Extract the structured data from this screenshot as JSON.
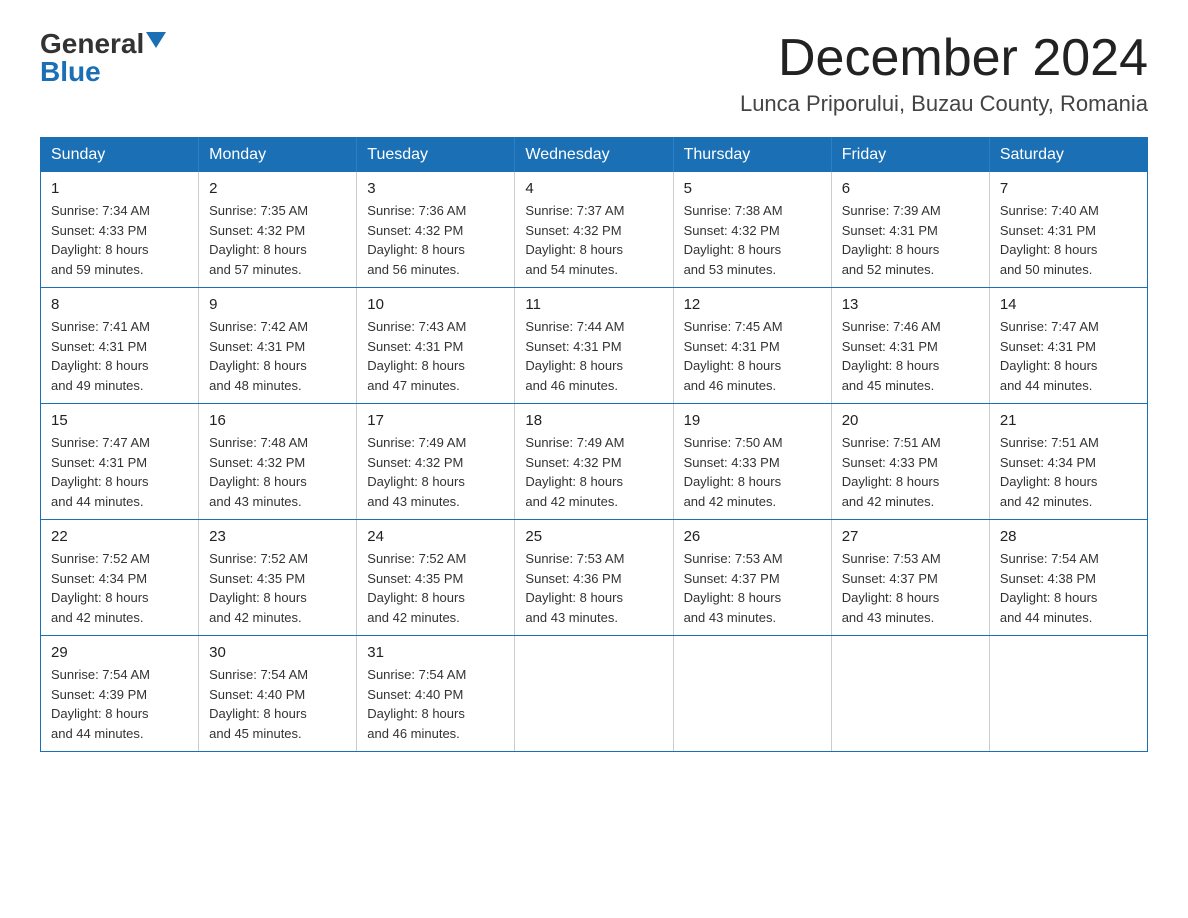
{
  "header": {
    "logo_general": "General",
    "logo_blue": "Blue",
    "month_title": "December 2024",
    "location": "Lunca Priporului, Buzau County, Romania"
  },
  "days_of_week": [
    "Sunday",
    "Monday",
    "Tuesday",
    "Wednesday",
    "Thursday",
    "Friday",
    "Saturday"
  ],
  "weeks": [
    [
      {
        "day": "1",
        "sunrise": "7:34 AM",
        "sunset": "4:33 PM",
        "daylight": "8 hours and 59 minutes."
      },
      {
        "day": "2",
        "sunrise": "7:35 AM",
        "sunset": "4:32 PM",
        "daylight": "8 hours and 57 minutes."
      },
      {
        "day": "3",
        "sunrise": "7:36 AM",
        "sunset": "4:32 PM",
        "daylight": "8 hours and 56 minutes."
      },
      {
        "day": "4",
        "sunrise": "7:37 AM",
        "sunset": "4:32 PM",
        "daylight": "8 hours and 54 minutes."
      },
      {
        "day": "5",
        "sunrise": "7:38 AM",
        "sunset": "4:32 PM",
        "daylight": "8 hours and 53 minutes."
      },
      {
        "day": "6",
        "sunrise": "7:39 AM",
        "sunset": "4:31 PM",
        "daylight": "8 hours and 52 minutes."
      },
      {
        "day": "7",
        "sunrise": "7:40 AM",
        "sunset": "4:31 PM",
        "daylight": "8 hours and 50 minutes."
      }
    ],
    [
      {
        "day": "8",
        "sunrise": "7:41 AM",
        "sunset": "4:31 PM",
        "daylight": "8 hours and 49 minutes."
      },
      {
        "day": "9",
        "sunrise": "7:42 AM",
        "sunset": "4:31 PM",
        "daylight": "8 hours and 48 minutes."
      },
      {
        "day": "10",
        "sunrise": "7:43 AM",
        "sunset": "4:31 PM",
        "daylight": "8 hours and 47 minutes."
      },
      {
        "day": "11",
        "sunrise": "7:44 AM",
        "sunset": "4:31 PM",
        "daylight": "8 hours and 46 minutes."
      },
      {
        "day": "12",
        "sunrise": "7:45 AM",
        "sunset": "4:31 PM",
        "daylight": "8 hours and 46 minutes."
      },
      {
        "day": "13",
        "sunrise": "7:46 AM",
        "sunset": "4:31 PM",
        "daylight": "8 hours and 45 minutes."
      },
      {
        "day": "14",
        "sunrise": "7:47 AM",
        "sunset": "4:31 PM",
        "daylight": "8 hours and 44 minutes."
      }
    ],
    [
      {
        "day": "15",
        "sunrise": "7:47 AM",
        "sunset": "4:31 PM",
        "daylight": "8 hours and 44 minutes."
      },
      {
        "day": "16",
        "sunrise": "7:48 AM",
        "sunset": "4:32 PM",
        "daylight": "8 hours and 43 minutes."
      },
      {
        "day": "17",
        "sunrise": "7:49 AM",
        "sunset": "4:32 PM",
        "daylight": "8 hours and 43 minutes."
      },
      {
        "day": "18",
        "sunrise": "7:49 AM",
        "sunset": "4:32 PM",
        "daylight": "8 hours and 42 minutes."
      },
      {
        "day": "19",
        "sunrise": "7:50 AM",
        "sunset": "4:33 PM",
        "daylight": "8 hours and 42 minutes."
      },
      {
        "day": "20",
        "sunrise": "7:51 AM",
        "sunset": "4:33 PM",
        "daylight": "8 hours and 42 minutes."
      },
      {
        "day": "21",
        "sunrise": "7:51 AM",
        "sunset": "4:34 PM",
        "daylight": "8 hours and 42 minutes."
      }
    ],
    [
      {
        "day": "22",
        "sunrise": "7:52 AM",
        "sunset": "4:34 PM",
        "daylight": "8 hours and 42 minutes."
      },
      {
        "day": "23",
        "sunrise": "7:52 AM",
        "sunset": "4:35 PM",
        "daylight": "8 hours and 42 minutes."
      },
      {
        "day": "24",
        "sunrise": "7:52 AM",
        "sunset": "4:35 PM",
        "daylight": "8 hours and 42 minutes."
      },
      {
        "day": "25",
        "sunrise": "7:53 AM",
        "sunset": "4:36 PM",
        "daylight": "8 hours and 43 minutes."
      },
      {
        "day": "26",
        "sunrise": "7:53 AM",
        "sunset": "4:37 PM",
        "daylight": "8 hours and 43 minutes."
      },
      {
        "day": "27",
        "sunrise": "7:53 AM",
        "sunset": "4:37 PM",
        "daylight": "8 hours and 43 minutes."
      },
      {
        "day": "28",
        "sunrise": "7:54 AM",
        "sunset": "4:38 PM",
        "daylight": "8 hours and 44 minutes."
      }
    ],
    [
      {
        "day": "29",
        "sunrise": "7:54 AM",
        "sunset": "4:39 PM",
        "daylight": "8 hours and 44 minutes."
      },
      {
        "day": "30",
        "sunrise": "7:54 AM",
        "sunset": "4:40 PM",
        "daylight": "8 hours and 45 minutes."
      },
      {
        "day": "31",
        "sunrise": "7:54 AM",
        "sunset": "4:40 PM",
        "daylight": "8 hours and 46 minutes."
      },
      null,
      null,
      null,
      null
    ]
  ],
  "labels": {
    "sunrise": "Sunrise:",
    "sunset": "Sunset:",
    "daylight": "Daylight:"
  }
}
